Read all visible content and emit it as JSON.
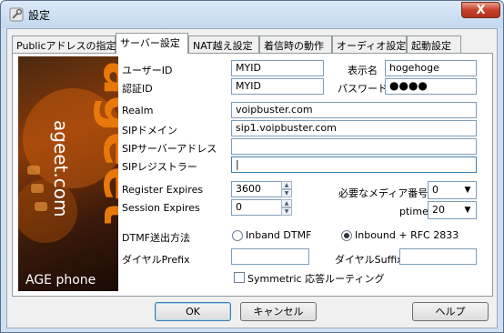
{
  "window": {
    "title": "設定",
    "close_label": "X"
  },
  "tabs": [
    {
      "label": "Publicアドレスの指定",
      "active": false
    },
    {
      "label": "サーバー設定",
      "active": true
    },
    {
      "label": "NAT越え設定",
      "active": false
    },
    {
      "label": "着信時の動作",
      "active": false
    },
    {
      "label": "オーディオ設定",
      "active": false
    },
    {
      "label": "起動設定",
      "active": false
    }
  ],
  "banner": {
    "brand_big": "ageet",
    "brand_url": "ageet.com",
    "product": "AGE phone"
  },
  "form": {
    "user_id_label": "ユーザーID",
    "user_id_value": "MYID",
    "display_name_label": "表示名",
    "display_name_value": "hogehoge",
    "auth_id_label": "認証ID",
    "auth_id_value": "MYID",
    "password_label": "パスワード",
    "password_value": "●●●●",
    "realm_label": "Realm",
    "realm_value": "voipbuster.com",
    "sip_domain_label": "SIPドメイン",
    "sip_domain_value": "sip1.voipbuster.com",
    "sip_server_label": "SIPサーバーアドレス",
    "sip_server_value": "",
    "sip_registrar_label": "SIPレジストラー",
    "sip_registrar_value": "|",
    "register_expires_label": "Register Expires",
    "register_expires_value": "3600",
    "session_expires_label": "Session Expires",
    "session_expires_value": "0",
    "media_number_label": "必要なメディア番号",
    "media_number_value": "0",
    "ptime_label": "ptime",
    "ptime_value": "20",
    "dtmf_label": "DTMF送出方法",
    "dtmf_inband_label": "Inband DTMF",
    "dtmf_rfc_label": "Inbound + RFC 2833",
    "dial_prefix_label": "ダイヤルPrefix",
    "dial_prefix_value": "",
    "dial_suffix_label": "ダイヤルSuffix",
    "dial_suffix_value": "",
    "symmetric_label": "Symmetric 応答ルーティング"
  },
  "buttons": {
    "ok": "OK",
    "cancel": "キャンセル",
    "help": "ヘルプ"
  },
  "colors": {
    "banner_orange": "#e8780a",
    "accent": "#3c7fb1"
  }
}
